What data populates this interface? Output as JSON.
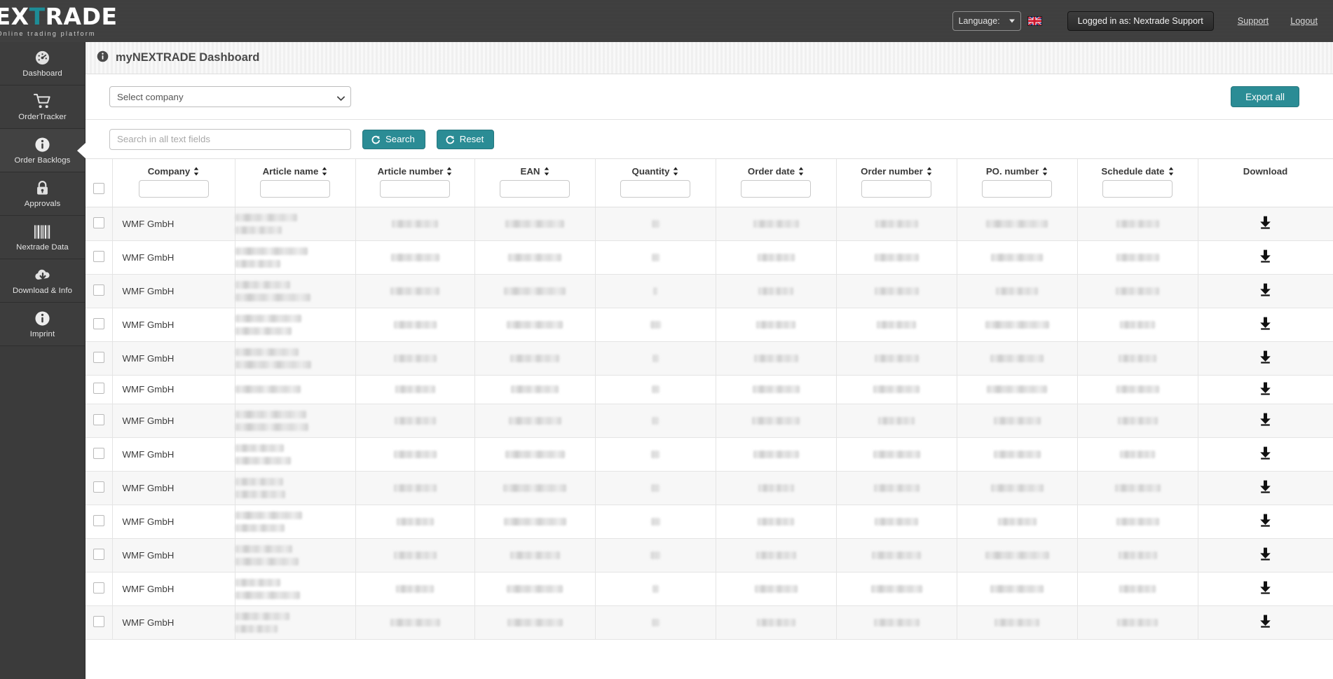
{
  "brand": {
    "name_part1": "NEX",
    "name_accent": "T",
    "name_part2": "RADE",
    "tagline": "Online trading platform",
    "accent_color": "#1d8c96"
  },
  "topbar": {
    "language_label": "Language:",
    "flag_icon": "uk-flag-icon",
    "logged_in_label": "Logged in as: Nextrade Support",
    "support_link": "Support",
    "logout_link": "Logout"
  },
  "sidebar": {
    "items": [
      {
        "label": "Dashboard",
        "icon": "gauge-icon",
        "active": false
      },
      {
        "label": "OrderTracker",
        "icon": "shopping-cart-icon",
        "active": false
      },
      {
        "label": "Order Backlogs",
        "icon": "info-circle-icon",
        "active": true
      },
      {
        "label": "Approvals",
        "icon": "lock-icon",
        "active": false
      },
      {
        "label": "Nextrade Data",
        "icon": "barcode-icon",
        "active": false
      },
      {
        "label": "Download & Info",
        "icon": "cloud-download-icon",
        "active": false
      },
      {
        "label": "Imprint",
        "icon": "info-circle-icon",
        "active": false
      }
    ]
  },
  "page": {
    "title": "myNEXTRADE Dashboard",
    "title_icon": "info-circle-icon"
  },
  "filters": {
    "company_select_value": "Select company",
    "export_all_label": "Export all",
    "search_placeholder": "Search in all text fields",
    "search_value": "",
    "search_button_label": "Search",
    "reset_button_label": "Reset",
    "button_color": "#2b8c95"
  },
  "table": {
    "columns": [
      {
        "key": "checkbox",
        "label": "",
        "sortable": false
      },
      {
        "key": "company",
        "label": "Company",
        "sortable": true
      },
      {
        "key": "article_name",
        "label": "Article name",
        "sortable": true
      },
      {
        "key": "article_number",
        "label": "Article number",
        "sortable": true
      },
      {
        "key": "ean",
        "label": "EAN",
        "sortable": true
      },
      {
        "key": "quantity",
        "label": "Quantity",
        "sortable": true
      },
      {
        "key": "order_date",
        "label": "Order date",
        "sortable": true
      },
      {
        "key": "order_number",
        "label": "Order number",
        "sortable": true
      },
      {
        "key": "po_number",
        "label": "PO. number",
        "sortable": true
      },
      {
        "key": "schedule_date",
        "label": "Schedule date",
        "sortable": true
      },
      {
        "key": "download",
        "label": "Download",
        "sortable": false
      }
    ],
    "rows": [
      {
        "company": "WMF GmbH",
        "article_name_lines": 2,
        "download_icon": "download-icon",
        "redacted": true
      },
      {
        "company": "WMF GmbH",
        "article_name_lines": 2,
        "download_icon": "download-icon",
        "redacted": true
      },
      {
        "company": "WMF GmbH",
        "article_name_lines": 2,
        "download_icon": "download-icon",
        "redacted": true
      },
      {
        "company": "WMF GmbH",
        "article_name_lines": 2,
        "download_icon": "download-icon",
        "redacted": true
      },
      {
        "company": "WMF GmbH",
        "article_name_lines": 2,
        "download_icon": "download-icon",
        "redacted": true
      },
      {
        "company": "WMF GmbH",
        "article_name_lines": 1,
        "download_icon": "download-icon",
        "redacted": true
      },
      {
        "company": "WMF GmbH",
        "article_name_lines": 2,
        "download_icon": "download-icon",
        "redacted": true
      },
      {
        "company": "WMF GmbH",
        "article_name_lines": 2,
        "download_icon": "download-icon",
        "redacted": true
      },
      {
        "company": "WMF GmbH",
        "article_name_lines": 2,
        "download_icon": "download-icon",
        "redacted": true
      },
      {
        "company": "WMF GmbH",
        "article_name_lines": 2,
        "download_icon": "download-icon",
        "redacted": true
      },
      {
        "company": "WMF GmbH",
        "article_name_lines": 2,
        "download_icon": "download-icon",
        "redacted": true
      },
      {
        "company": "WMF GmbH",
        "article_name_lines": 2,
        "download_icon": "download-icon",
        "redacted": true
      },
      {
        "company": "WMF GmbH",
        "article_name_lines": 2,
        "download_icon": "download-icon",
        "redacted": true
      }
    ]
  }
}
